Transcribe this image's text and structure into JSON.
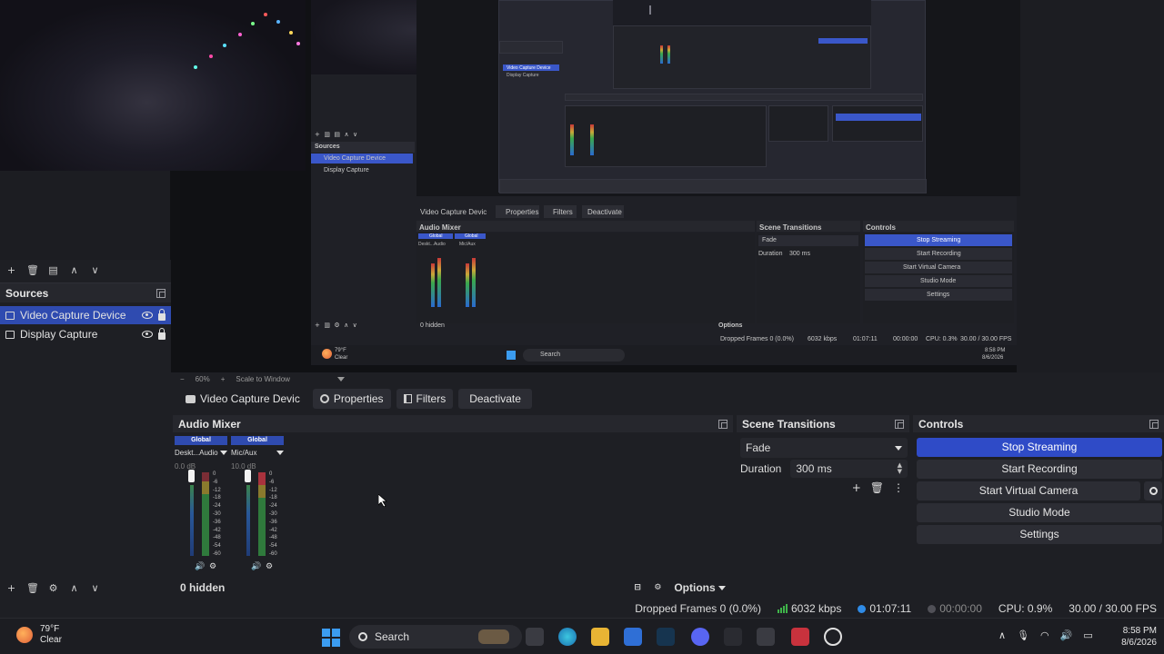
{
  "sources": {
    "title": "Sources",
    "items": [
      {
        "label": "Video Capture Device",
        "selected": true
      },
      {
        "label": "Display Capture",
        "selected": false
      }
    ]
  },
  "preview": {
    "inner": {
      "sources_title": "Sources",
      "source_1": "Video Capture Device",
      "source_2": "Display Capture",
      "ctx_source": "Video Capture Devic",
      "ctx_properties": "Properties",
      "ctx_filters": "Filters",
      "ctx_deactivate": "Deactivate",
      "audio_mixer": "Audio Mixer",
      "ch1_label": "Global",
      "ch1_name": "Deskt...Audio",
      "ch1_db": "0.0 dB",
      "ch2_label": "Global",
      "ch2_name": "Mic/Aux",
      "ch2_db": "10.0 dB",
      "hidden": "0 hidden",
      "options": "Options",
      "scene_transitions": "Scene Transitions",
      "fade": "Fade",
      "duration": "Duration",
      "duration_value": "300 ms",
      "controls": "Controls",
      "stop_streaming": "Stop Streaming",
      "start_recording": "Start Recording",
      "start_virtual_camera": "Start Virtual Camera",
      "studio_mode": "Studio Mode",
      "settings": "Settings",
      "status": "Dropped Frames 0 (0.0%)",
      "kbps": "6032 kbps",
      "time1": "01:07:11",
      "time2": "00:00:00",
      "cpu": "CPU: 0.3%",
      "fps": "30.00 / 30.00 FPS",
      "weather_temp": "79°F",
      "weather_desc": "Clear",
      "search": "Search",
      "clock_time": "8:58 PM",
      "clock_date": "8/6/2026"
    }
  },
  "zoombar": {
    "minus": "−",
    "zoom": "60%",
    "plus": "+",
    "mode": "Scale to Window"
  },
  "context_bar": {
    "source": "Video Capture Devic",
    "properties": "Properties",
    "filters": "Filters",
    "deactivate": "Deactivate"
  },
  "audio_mixer": {
    "title": "Audio Mixer",
    "channels": [
      {
        "label": "Global",
        "name": "Deskt...Audio",
        "db": "0.0 dB"
      },
      {
        "label": "Global",
        "name": "Mic/Aux",
        "db": "10.0 dB"
      }
    ],
    "scale": [
      "0",
      "-6",
      "-12",
      "-18",
      "-24",
      "-30",
      "-36",
      "-42",
      "-48",
      "-54",
      "-60"
    ],
    "hidden_count": "0 hidden",
    "options": "Options"
  },
  "scene_transitions": {
    "title": "Scene Transitions",
    "selected": "Fade",
    "duration_label": "Duration",
    "duration_value": "300 ms"
  },
  "controls": {
    "title": "Controls",
    "buttons": [
      {
        "label": "Stop Streaming",
        "active": true
      },
      {
        "label": "Start Recording",
        "active": false
      },
      {
        "label": "Start Virtual Camera",
        "active": false
      },
      {
        "label": "Studio Mode",
        "active": false
      },
      {
        "label": "Settings",
        "active": false
      }
    ]
  },
  "status_bar": {
    "dropped_frames": "Dropped Frames 0 (0.0%)",
    "bitrate": "6032 kbps",
    "stream_time": "01:07:11",
    "record_time": "00:00:00",
    "cpu": "CPU: 0.9%",
    "fps": "30.00 / 30.00 FPS"
  },
  "taskbar": {
    "temperature": "79°F",
    "weather": "Clear",
    "search_label": "Search",
    "time": "8:58 PM",
    "date": "8/6/2026"
  },
  "colors": {
    "accent": "#2f4bc7",
    "selection": "#2f4bb0",
    "panel": "#26272d",
    "background": "#1e1f24"
  }
}
